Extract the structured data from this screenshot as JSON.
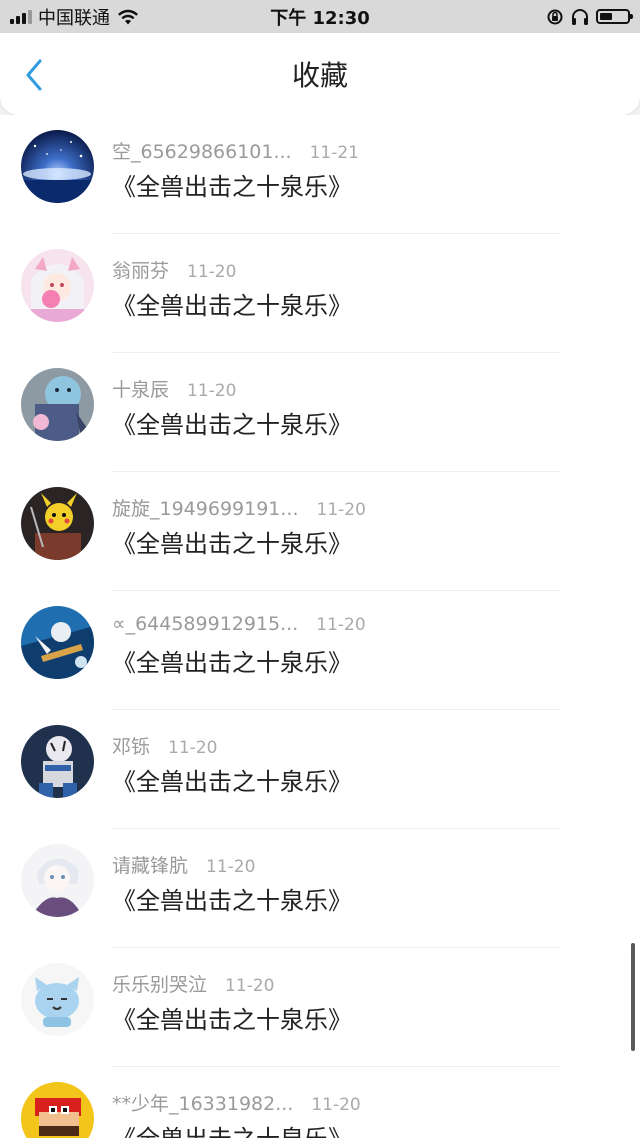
{
  "status_bar": {
    "carrier": "中国联通",
    "time": "下午 12:30",
    "battery_level": 0.45
  },
  "header": {
    "title": "收藏",
    "back_icon": "chevron-left-icon"
  },
  "items": [
    {
      "user": "空_65629866101...",
      "date": "11-21",
      "content": "《全兽出击之十泉乐》"
    },
    {
      "user": "翁丽芬",
      "date": "11-20",
      "content": "《全兽出击之十泉乐》"
    },
    {
      "user": "十泉辰",
      "date": "11-20",
      "content": "《全兽出击之十泉乐》"
    },
    {
      "user": "旋旋_1949699191...",
      "date": "11-20",
      "content": "《全兽出击之十泉乐》"
    },
    {
      "user": "∝_644589912915...",
      "date": "11-20",
      "content": "《全兽出击之十泉乐》"
    },
    {
      "user": "邓铄",
      "date": "11-20",
      "content": "《全兽出击之十泉乐》"
    },
    {
      "user": "请藏锋肮",
      "date": "11-20",
      "content": "《全兽出击之十泉乐》"
    },
    {
      "user": "乐乐别哭泣",
      "date": "11-20",
      "content": "《全兽出击之十泉乐》"
    },
    {
      "user": "**少年_16331982...",
      "date": "11-20",
      "content": "《全兽出击之十泉乐》"
    }
  ],
  "colors": {
    "accent": "#2f9be0",
    "background": "#f1f1f1"
  }
}
